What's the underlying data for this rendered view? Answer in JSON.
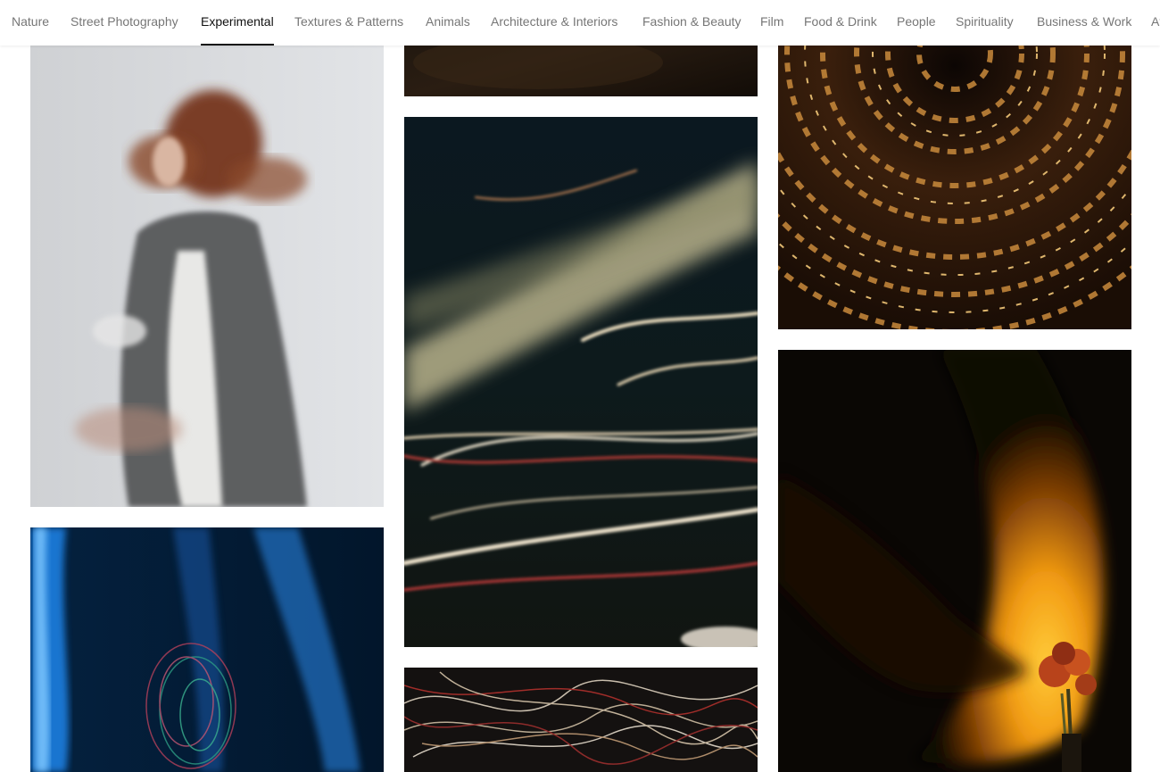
{
  "topics_nav": {
    "items": [
      {
        "id": "nature",
        "label": "Nature"
      },
      {
        "id": "street-photography",
        "label": "Street Photography"
      },
      {
        "id": "experimental",
        "label": "Experimental",
        "active": true
      },
      {
        "id": "textures-patterns",
        "label": "Textures & Patterns"
      },
      {
        "id": "animals",
        "label": "Animals"
      },
      {
        "id": "architecture-interiors",
        "label": "Architecture & Interiors"
      },
      {
        "id": "fashion-beauty",
        "label": "Fashion & Beauty"
      },
      {
        "id": "film",
        "label": "Film"
      },
      {
        "id": "food-drink",
        "label": "Food & Drink"
      },
      {
        "id": "people",
        "label": "People"
      },
      {
        "id": "spirituality",
        "label": "Spirituality"
      },
      {
        "id": "business-work",
        "label": "Business & Work"
      },
      {
        "id": "athletics-partial",
        "label": "At"
      }
    ],
    "colors": {
      "inactive": "#767676",
      "active": "#111111"
    }
  },
  "gallery": {
    "columns": 3,
    "photos": [
      {
        "id": "dark-warm-partial",
        "column": 2,
        "subject": "dark warm-toned photo (cropped at top)"
      },
      {
        "id": "swirl-texture",
        "column": 3,
        "subject": "golden swirling texture pattern"
      },
      {
        "id": "woman-motion-blur",
        "column": 1,
        "subject": "woman with motion blur against grey wall"
      },
      {
        "id": "light-trails",
        "column": 2,
        "subject": "long exposure light trails at night"
      },
      {
        "id": "flower-sunset-lamp",
        "column": 3,
        "subject": "flowers in orange lamp light with shadow"
      },
      {
        "id": "blue-light-abstract",
        "column": 1,
        "subject": "blue abstract light streaks"
      },
      {
        "id": "scribble-lights",
        "column": 2,
        "subject": "tangled light scribbles on dark background"
      }
    ]
  }
}
